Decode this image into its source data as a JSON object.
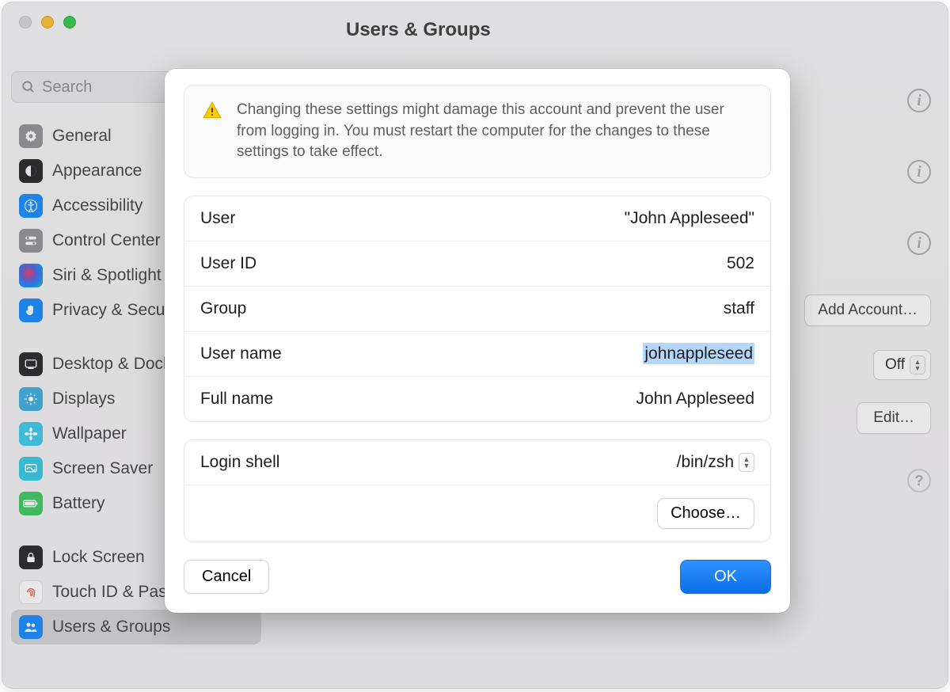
{
  "window": {
    "title": "Users & Groups"
  },
  "search": {
    "placeholder": "Search"
  },
  "sidebar": {
    "items": [
      {
        "label": "General",
        "icon": "gear-icon",
        "bg": "#8e8e93"
      },
      {
        "label": "Appearance",
        "icon": "contrast-icon",
        "bg": "#1c1c1e"
      },
      {
        "label": "Accessibility",
        "icon": "person-icon",
        "bg": "#0a84ff"
      },
      {
        "label": "Control Center",
        "icon": "switches-icon",
        "bg": "#8e8e93"
      },
      {
        "label": "Siri & Spotlight",
        "icon": "siri-icon",
        "bg": "#000000"
      },
      {
        "label": "Privacy & Security",
        "icon": "hand-icon",
        "bg": "#0a84ff"
      },
      {
        "label": "Desktop & Dock",
        "icon": "dock-icon",
        "bg": "#1c1c1e"
      },
      {
        "label": "Displays",
        "icon": "sun-icon",
        "bg": "#34aadc"
      },
      {
        "label": "Wallpaper",
        "icon": "flower-icon",
        "bg": "#34c8ee"
      },
      {
        "label": "Screen Saver",
        "icon": "screensaver-icon",
        "bg": "#2bc7e3"
      },
      {
        "label": "Battery",
        "icon": "battery-icon",
        "bg": "#34c759"
      },
      {
        "label": "Lock Screen",
        "icon": "lock-icon",
        "bg": "#1c1c1e"
      },
      {
        "label": "Touch ID & Password",
        "icon": "fingerprint-icon",
        "bg": "#ffffff"
      },
      {
        "label": "Users & Groups",
        "icon": "people-icon",
        "bg": "#0a84ff",
        "selected": true
      }
    ]
  },
  "right_pane": {
    "add_account": "Add Account…",
    "auto_login_toggle": "Off",
    "edit_button": "Edit…"
  },
  "sheet": {
    "warning": "Changing these settings might damage this account and prevent the user from logging in. You must restart the computer for the changes to these settings to take effect.",
    "rows": {
      "user": {
        "label": "User",
        "value": "\"John Appleseed\""
      },
      "user_id": {
        "label": "User ID",
        "value": "502"
      },
      "group": {
        "label": "Group",
        "value": "staff"
      },
      "user_name": {
        "label": "User name",
        "value": "johnappleseed"
      },
      "full_name": {
        "label": "Full name",
        "value": "John Appleseed"
      },
      "login_shell": {
        "label": "Login shell",
        "value": "/bin/zsh"
      }
    },
    "choose_button": "Choose…",
    "cancel": "Cancel",
    "ok": "OK"
  }
}
